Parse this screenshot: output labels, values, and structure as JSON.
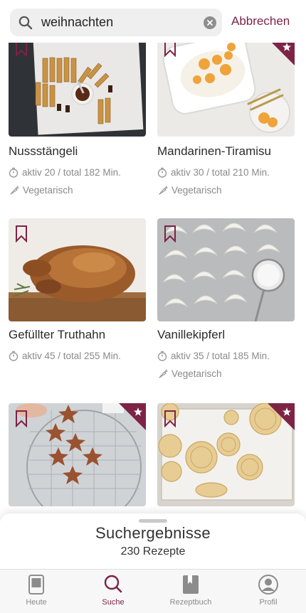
{
  "search": {
    "query": "weihnachten",
    "cancel_label": "Abbrechen"
  },
  "colors": {
    "accent": "#7d2346",
    "meta_text": "#8a8a8a",
    "field_bg": "#efefef"
  },
  "recipes": [
    {
      "title": "Nussstängeli",
      "time": "aktiv 20 / total 182 Min.",
      "tag": "Vegetarisch",
      "corner_star": false,
      "image_icon": "nut-sticks-photo"
    },
    {
      "title": "Mandarinen-Tiramisu",
      "time": "aktiv 30 / total 210 Min.",
      "tag": "Vegetarisch",
      "corner_star": true,
      "image_icon": "tiramisu-photo"
    },
    {
      "title": "Gefüllter Truthahn",
      "time": "aktiv 45 / total 255 Min.",
      "tag": "",
      "corner_star": false,
      "image_icon": "roast-turkey-photo"
    },
    {
      "title": "Vanillekipferl",
      "time": "aktiv 35 / total 185 Min.",
      "tag": "Vegetarisch",
      "corner_star": false,
      "image_icon": "vanilla-crescents-photo"
    },
    {
      "title": "",
      "time": "",
      "tag": "",
      "corner_star": true,
      "image_icon": "gingerbread-stars-photo"
    },
    {
      "title": "",
      "time": "",
      "tag": "",
      "corner_star": true,
      "image_icon": "springerle-cookies-photo"
    }
  ],
  "results": {
    "heading": "Suchergebnisse",
    "count": "230 Rezepte"
  },
  "tabs": [
    {
      "label": "Heute",
      "icon": "today-icon",
      "active": false
    },
    {
      "label": "Suche",
      "icon": "search-icon",
      "active": true
    },
    {
      "label": "Rezeptbuch",
      "icon": "recipe-book-icon",
      "active": false
    },
    {
      "label": "Profil",
      "icon": "profile-icon",
      "active": false
    }
  ]
}
